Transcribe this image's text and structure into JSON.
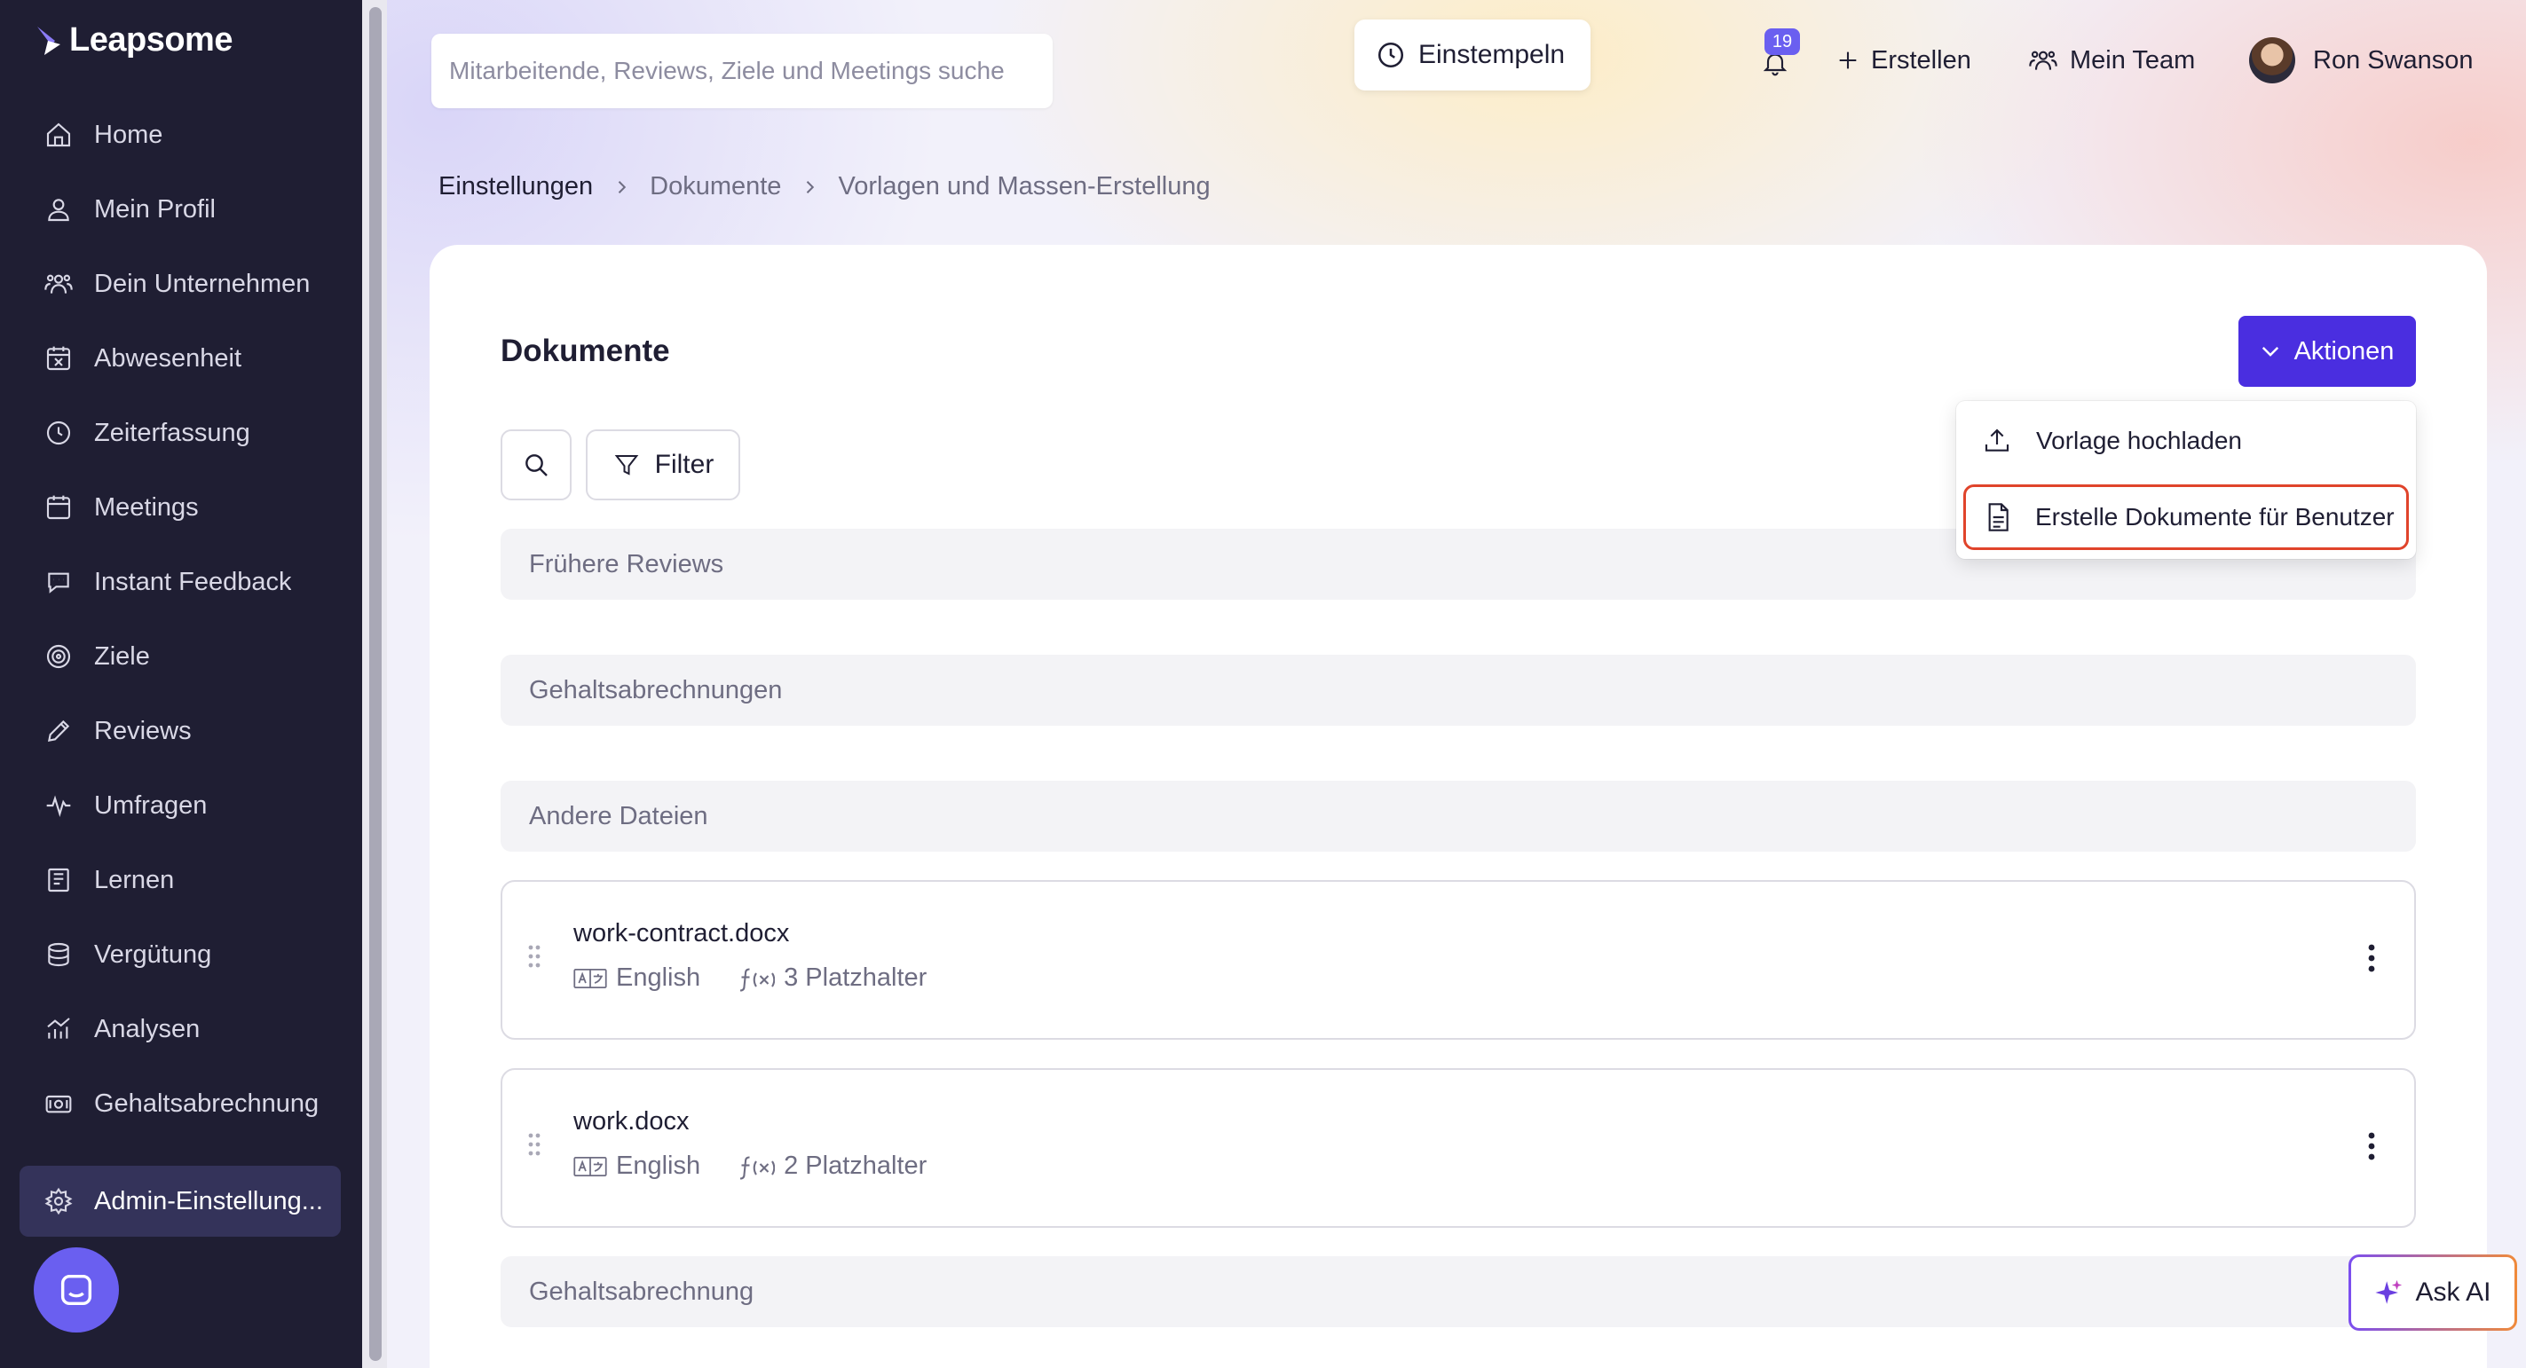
{
  "brand": {
    "name": "Leapsome",
    "accent": "#4a2ee0",
    "sidebar_bg": "#1f1e33"
  },
  "sidebar": {
    "items": [
      {
        "label": "Home",
        "icon": "home-icon"
      },
      {
        "label": "Mein Profil",
        "icon": "user-icon"
      },
      {
        "label": "Dein Unternehmen",
        "icon": "users-icon"
      },
      {
        "label": "Abwesenheit",
        "icon": "calendar-x-icon"
      },
      {
        "label": "Zeiterfassung",
        "icon": "clock-icon"
      },
      {
        "label": "Meetings",
        "icon": "calendar-icon"
      },
      {
        "label": "Instant Feedback",
        "icon": "chat-icon"
      },
      {
        "label": "Ziele",
        "icon": "target-icon"
      },
      {
        "label": "Reviews",
        "icon": "pencil-icon"
      },
      {
        "label": "Umfragen",
        "icon": "pulse-icon"
      },
      {
        "label": "Lernen",
        "icon": "book-icon"
      },
      {
        "label": "Vergütung",
        "icon": "coins-icon"
      },
      {
        "label": "Analysen",
        "icon": "chart-icon"
      },
      {
        "label": "Gehaltsabrechnung",
        "icon": "cash-icon"
      }
    ],
    "admin": {
      "label": "Admin-Einstellung...",
      "icon": "gear-icon"
    }
  },
  "topbar": {
    "search_placeholder": "Mitarbeitende, Reviews, Ziele und Meetings suche",
    "clock_in": "Einstempeln",
    "notifications_count": "19",
    "create": "Erstellen",
    "my_team": "Mein Team",
    "user_name": "Ron Swanson"
  },
  "breadcrumb": [
    "Einstellungen",
    "Dokumente",
    "Vorlagen und Massen-Erstellung"
  ],
  "page": {
    "title": "Dokumente",
    "actions_label": "Aktionen",
    "filter_label": "Filter",
    "dropdown": [
      {
        "label": "Vorlage hochladen",
        "icon": "upload-icon"
      },
      {
        "label": "Erstelle Dokumente für Benutzer",
        "icon": "file-icon"
      }
    ],
    "sections": [
      {
        "label": "Frühere Reviews"
      },
      {
        "label": "Gehaltsabrechnungen"
      },
      {
        "label": "Andere Dateien"
      },
      {
        "label": "Gehaltsabrechnung"
      }
    ],
    "documents": [
      {
        "name": "work-contract.docx",
        "language": "English",
        "placeholders": "3 Platzhalter"
      },
      {
        "name": "work.docx",
        "language": "English",
        "placeholders": "2 Platzhalter"
      }
    ]
  },
  "ask_ai": "Ask AI"
}
